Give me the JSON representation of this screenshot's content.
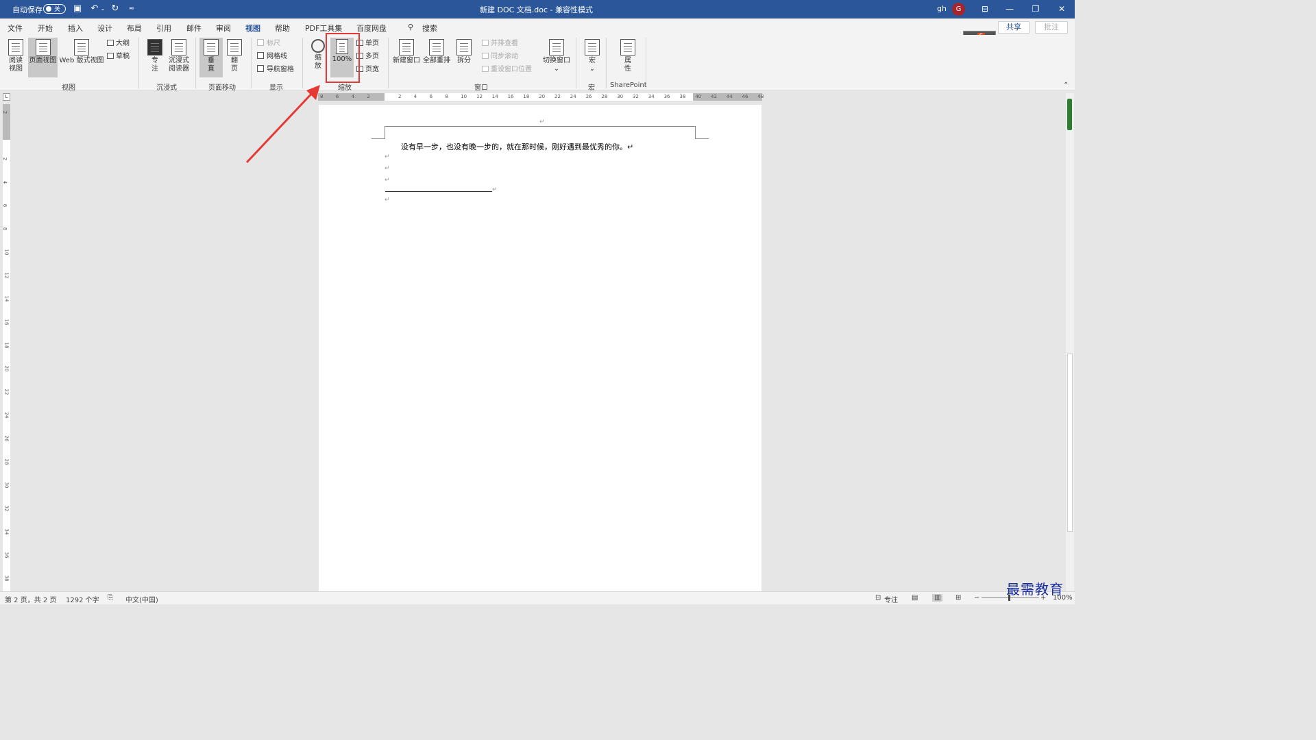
{
  "titlebar": {
    "autosave_label": "自动保存",
    "autosave_state": "关",
    "title": "新建 DOC 文档.doc  -  兼容性模式",
    "user": "gh",
    "avatar_initial": "G"
  },
  "tabs": [
    "文件",
    "开始",
    "插入",
    "设计",
    "布局",
    "引用",
    "邮件",
    "审阅",
    "视图",
    "帮助",
    "PDF工具集",
    "百度网盘"
  ],
  "active_tab": "视图",
  "search_label": "搜索",
  "share_label": "共享",
  "comment_label": "批注",
  "ribbon": {
    "view": {
      "read_view": "阅读\n视图",
      "print_layout": "页面视图",
      "web_layout": "Web 版式视图",
      "outline": "大纲",
      "draft": "草稿",
      "group": "视图"
    },
    "immersive": {
      "focus": "专\n注",
      "immersive_reader": "沉浸式\n阅读器",
      "group": "沉浸式"
    },
    "page_movement": {
      "vertical": "垂\n直",
      "side_to_side": "翻\n页",
      "group": "页面移动"
    },
    "show": {
      "ruler": "标尺",
      "gridlines": "网格线",
      "nav_pane": "导航窗格",
      "group": "显示"
    },
    "zoom": {
      "zoom": "缩\n放",
      "hundred": "100%",
      "one_page": "单页",
      "multiple_pages": "多页",
      "page_width": "页宽",
      "group": "缩放"
    },
    "window": {
      "new_window": "新建窗口",
      "arrange_all": "全部重排",
      "split": "拆分",
      "side_by_side": "并排查看",
      "sync_scroll": "同步滚动",
      "reset_position": "重设窗口位置",
      "switch_windows": "切换窗口",
      "group": "窗口"
    },
    "macros": {
      "macros": "宏",
      "group": "宏"
    },
    "sharepoint": {
      "properties": "属\n性",
      "group": "SharePoint"
    }
  },
  "ruler_numbers": [
    "8",
    "6",
    "4",
    "2",
    "",
    "2",
    "4",
    "6",
    "8",
    "10",
    "12",
    "14",
    "16",
    "18",
    "20",
    "22",
    "24",
    "26",
    "28",
    "30",
    "32",
    "34",
    "36",
    "38",
    "40",
    "42",
    "44",
    "46",
    "48"
  ],
  "vruler_numbers": [
    "2",
    "",
    "2",
    "4",
    "6",
    "8",
    "10",
    "12",
    "14",
    "16",
    "18",
    "20",
    "22",
    "24",
    "26",
    "28",
    "30",
    "32",
    "34",
    "36",
    "38"
  ],
  "document": {
    "header_mark": "↵",
    "line1": "没有早一步，也没有晚一步的，就在那时候，刚好遇到最优秀的你。↵",
    "marks": [
      "↵",
      "↵",
      "↵",
      "↵",
      "↵"
    ]
  },
  "statusbar": {
    "page": "第 2 页，共 2 页",
    "words": "1292 个字",
    "language": "中文(中国)",
    "focus": "专注",
    "zoom": "100%"
  },
  "watermark": "最需教育"
}
